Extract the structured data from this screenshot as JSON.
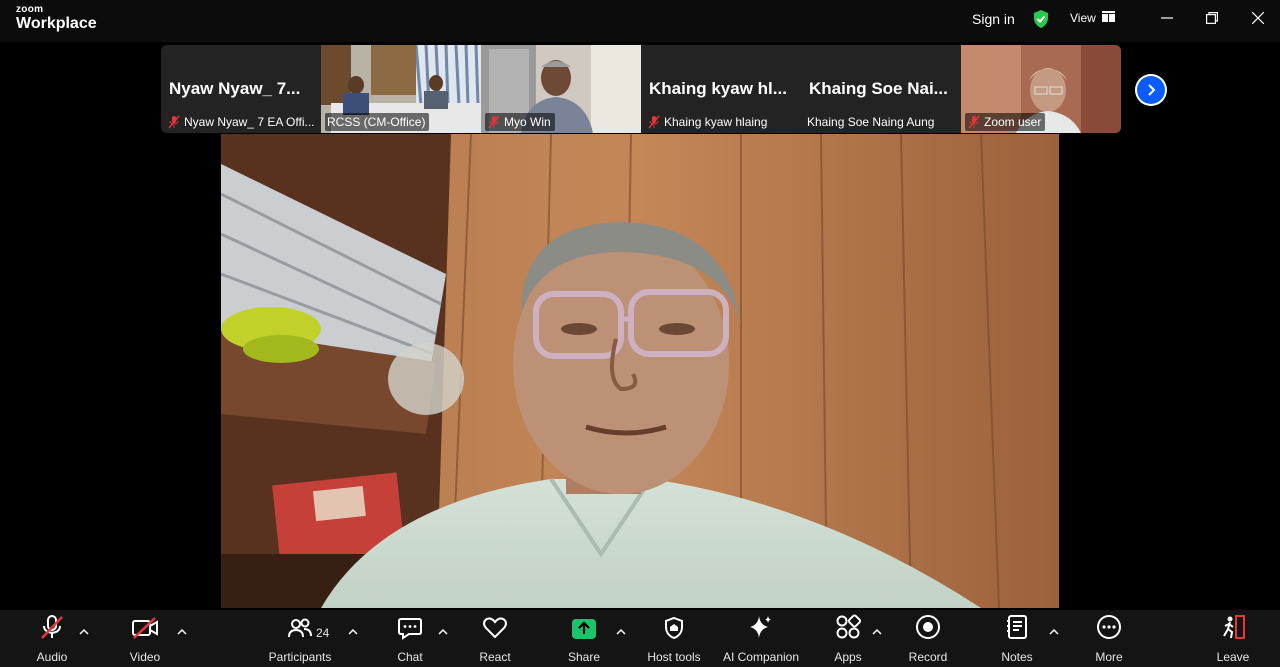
{
  "app": {
    "logo_small": "zoom",
    "logo_big": "Workplace",
    "sign_in": "Sign in",
    "view": "View"
  },
  "gallery": [
    {
      "big_name": "Nyaw  Nyaw_  7...",
      "label": "Nyaw Nyaw_ 7 EA Offi...",
      "muted": true,
      "video": false
    },
    {
      "big_name": "",
      "label": "RCSS (CM-Office)",
      "muted": false,
      "video": true
    },
    {
      "big_name": "",
      "label": "Myo Win",
      "muted": true,
      "video": true
    },
    {
      "big_name": "Khaing  kyaw  hl...",
      "label": "Khaing kyaw hlaing",
      "muted": true,
      "video": false
    },
    {
      "big_name": "Khaing   Soe  Nai...",
      "label": "Khaing  Soe Naing Aung",
      "muted": false,
      "video": false
    },
    {
      "big_name": "",
      "label": "Zoom user",
      "muted": true,
      "video": true
    }
  ],
  "toolbar": {
    "audio": "Audio",
    "video": "Video",
    "participants": "Participants",
    "participants_count": "24",
    "chat": "Chat",
    "react": "React",
    "share": "Share",
    "host_tools": "Host tools",
    "ai_companion": "AI Companion",
    "apps": "Apps",
    "record": "Record",
    "notes": "Notes",
    "more": "More",
    "leave": "Leave"
  },
  "colors": {
    "accent_blue": "#0b5cff",
    "share_green": "#1ec26a",
    "mute_red": "#e5353d",
    "shield_green": "#2bc84b"
  }
}
